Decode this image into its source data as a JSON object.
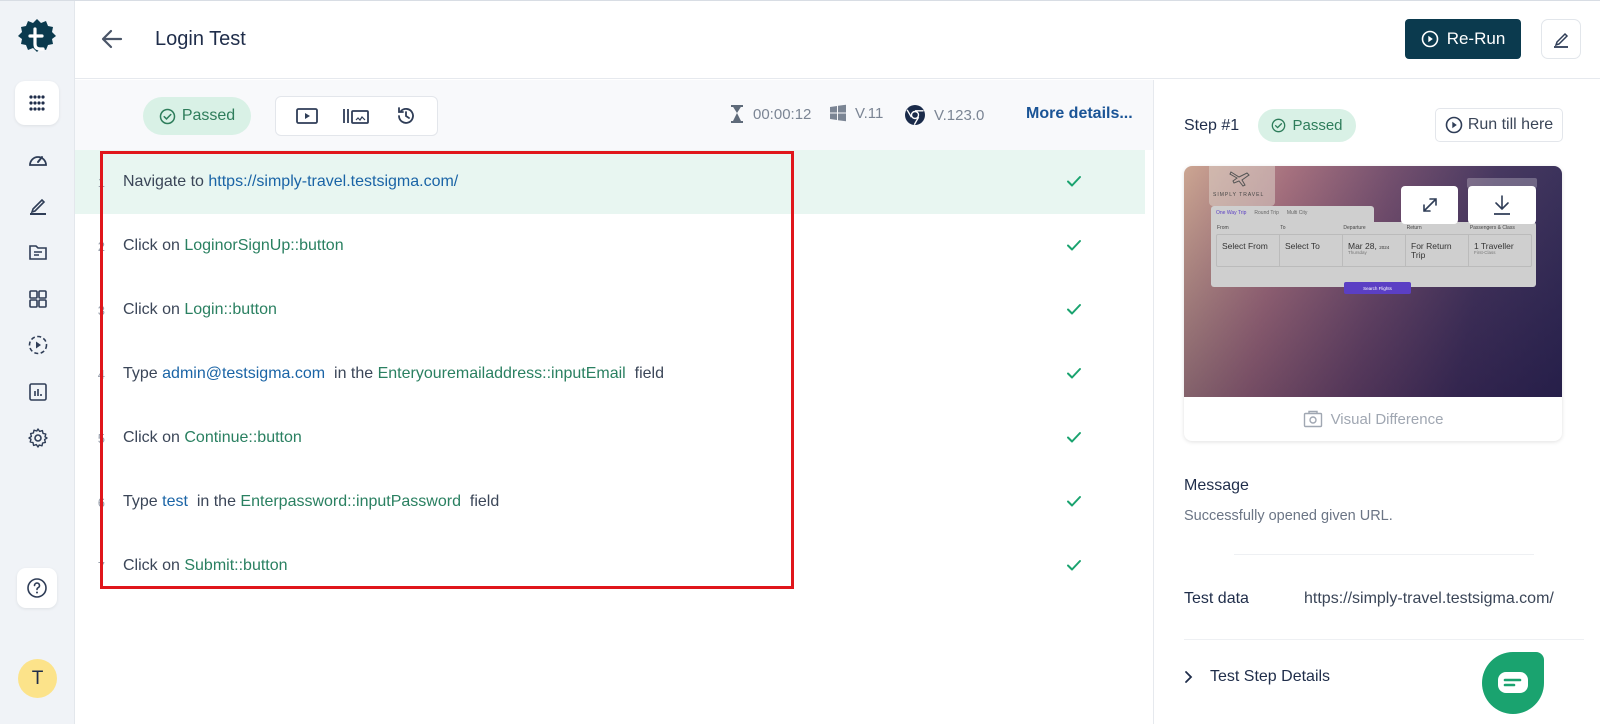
{
  "header": {
    "title": "Login Test",
    "rerun_label": "Re-Run"
  },
  "user": {
    "initial": "T"
  },
  "nav": {
    "items": [
      {
        "name": "dashboard"
      },
      {
        "name": "create-tests"
      },
      {
        "name": "test-files"
      },
      {
        "name": "test-suites"
      },
      {
        "name": "runs"
      },
      {
        "name": "reports"
      },
      {
        "name": "settings"
      }
    ]
  },
  "toolbar": {
    "status": "Passed",
    "duration": "00:00:12",
    "os_version": "V.11",
    "browser_version": "V.123.0",
    "more_details": "More details..."
  },
  "steps": [
    {
      "num": "1",
      "parts": [
        {
          "t": "kw",
          "v": "Navigate to "
        },
        {
          "t": "td",
          "v": "https://simply-travel.testsigma.com/"
        }
      ],
      "status": "passed",
      "active": true
    },
    {
      "num": "2",
      "parts": [
        {
          "t": "kw",
          "v": "Click on "
        },
        {
          "t": "el",
          "v": "LoginorSignUp::button"
        }
      ],
      "status": "passed"
    },
    {
      "num": "3",
      "parts": [
        {
          "t": "kw",
          "v": "Click on "
        },
        {
          "t": "el",
          "v": "Login::button"
        }
      ],
      "status": "passed"
    },
    {
      "num": "4",
      "parts": [
        {
          "t": "kw",
          "v": "Type "
        },
        {
          "t": "td",
          "v": "admin@testsigma.com"
        },
        {
          "t": "kw",
          "v": " in the "
        },
        {
          "t": "el",
          "v": "Enteryouremailaddress::inputEmail"
        },
        {
          "t": "kw",
          "v": " field"
        }
      ],
      "status": "passed"
    },
    {
      "num": "5",
      "parts": [
        {
          "t": "kw",
          "v": "Click on "
        },
        {
          "t": "el",
          "v": "Continue::button"
        }
      ],
      "status": "passed"
    },
    {
      "num": "6",
      "parts": [
        {
          "t": "kw",
          "v": "Type "
        },
        {
          "t": "td",
          "v": "test"
        },
        {
          "t": "kw",
          "v": " in the "
        },
        {
          "t": "el",
          "v": "Enterpassword::inputPassword"
        },
        {
          "t": "kw",
          "v": " field"
        }
      ],
      "status": "passed"
    },
    {
      "num": "7",
      "parts": [
        {
          "t": "kw",
          "v": "Click on "
        },
        {
          "t": "el",
          "v": "Submit::button"
        }
      ],
      "status": "passed"
    }
  ],
  "panel": {
    "step_label": "Step #1",
    "status": "Passed",
    "run_till_here": "Run till here",
    "screenshot": {
      "brand": "SIMPLY TRAVEL",
      "trip_tabs": [
        "One Way Trip",
        "Round Trip",
        "Multi City"
      ],
      "field_labels": [
        "From",
        "To",
        "Departure",
        "Return",
        "Passengers & Class"
      ],
      "from": "Select From",
      "to": "Select To",
      "departure": "Mar 28,",
      "departure_year": "2024",
      "departure_day": "Thursday",
      "return": "For Return Trip",
      "passengers": "1 Traveller",
      "class": "First-Class",
      "search_button": "Search Flights"
    },
    "visual_difference": "Visual Difference",
    "message_title": "Message",
    "message_text": "Successfully opened given URL.",
    "test_data_label": "Test data",
    "test_data_value": "https://simply-travel.testsigma.com/",
    "details_toggle": "Test Step Details"
  },
  "colors": {
    "brand_dark": "#0b3a4e",
    "passed_bg": "#d9f1e6",
    "passed_text": "#2e7d5b",
    "check_green": "#1aa36f",
    "link_blue": "#1a5496",
    "highlight_red": "#e0161b"
  }
}
